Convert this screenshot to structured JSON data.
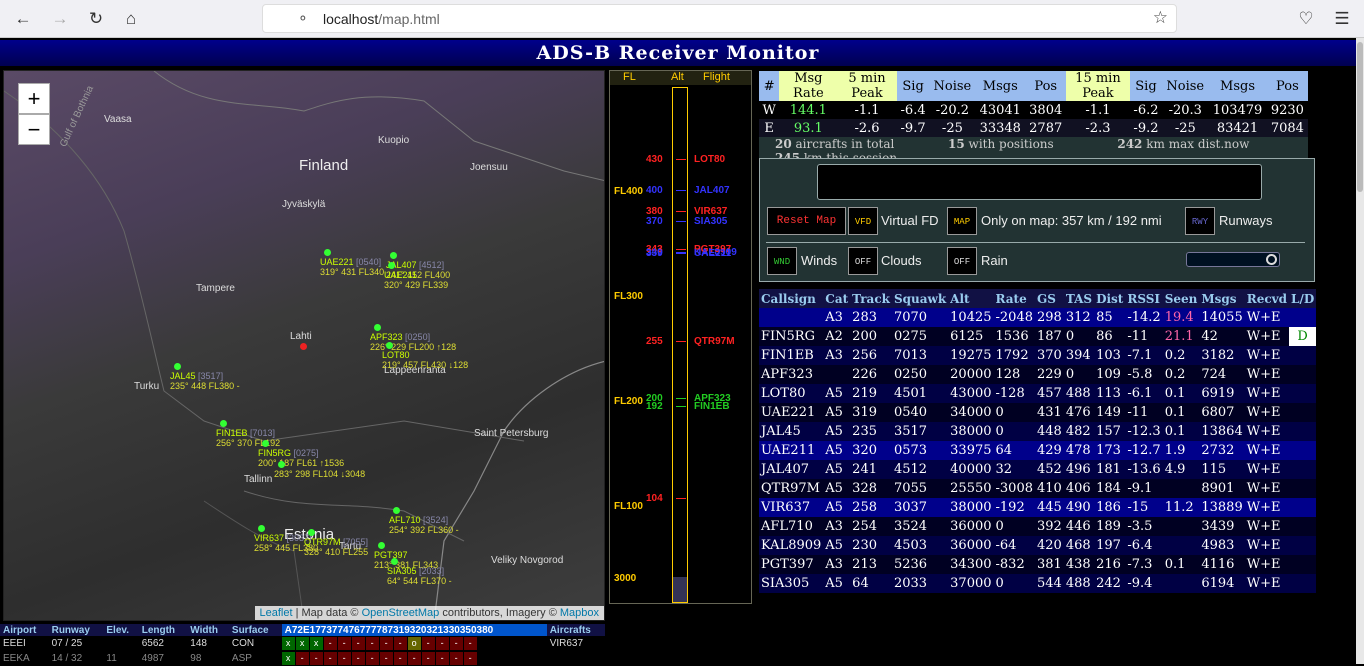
{
  "browser": {
    "url_host": "localhost",
    "url_path": "/map.html"
  },
  "title": "ADS-B Receiver Monitor",
  "map": {
    "zoom_in": "+",
    "zoom_out": "−",
    "cities": [
      {
        "name": "Finland",
        "big": true
      },
      {
        "name": "Vaasa"
      },
      {
        "name": "Kuopio"
      },
      {
        "name": "Joensuu"
      },
      {
        "name": "Jyväskylä"
      },
      {
        "name": "Tampere"
      },
      {
        "name": "Lahti"
      },
      {
        "name": "Lappeenranta"
      },
      {
        "name": "Turku"
      },
      {
        "name": "Tallinn"
      },
      {
        "name": "Estonia",
        "big": true
      },
      {
        "name": "Saint Petersburg"
      },
      {
        "name": "Tartu"
      },
      {
        "name": "Veliky Novgorod"
      },
      {
        "name": "Gulf of Bothnia"
      }
    ],
    "aircraft_labels": [
      {
        "cs": "UAE221",
        "sq": "[0540]",
        "info": "319° 431 FL340"
      },
      {
        "cs": "JAL407",
        "sq": "[4512]",
        "info": "241° 452 FL400"
      },
      {
        "cs": "UAE211",
        "sq": "",
        "info": "320° 429 FL339"
      },
      {
        "cs": "APF323",
        "sq": "[0250]",
        "info": "226° 229 FL200 ↑128"
      },
      {
        "cs": "LOT80",
        "sq": "",
        "info": "219° 457 FL430 ↓128"
      },
      {
        "cs": "JAL45",
        "sq": "[3517]",
        "info": "235° 448 FL380 -"
      },
      {
        "cs": "FIN1EB",
        "sq": "[7013]",
        "info": "256° 370 FL192"
      },
      {
        "cs": "FIN5RG",
        "sq": "[0275]",
        "info": "200° 187 FL61 ↑1536"
      },
      {
        "cs": "",
        "sq": "",
        "info": "283° 298 FL104 ↓3048"
      },
      {
        "cs": "AFL710",
        "sq": "[3524]",
        "info": "254° 392 FL360 -"
      },
      {
        "cs": "VIR637",
        "sq": "[3037]",
        "info": "258° 445 FL380"
      },
      {
        "cs": "QTR97M",
        "sq": "[7055]",
        "info": "328° 410 FL255"
      },
      {
        "cs": "PGT397",
        "sq": "",
        "info": "213° 381 FL343"
      },
      {
        "cs": "SIA305",
        "sq": "[2033]",
        "info": "64° 544 FL370 -"
      }
    ],
    "attribution": {
      "leaflet": "Leaflet",
      "mid": " | Map data © ",
      "osm": "OpenStreetMap",
      "mid2": " contributors, Imagery © ",
      "mapbox": "Mapbox"
    }
  },
  "altitude_panel": {
    "headers": [
      "FL",
      "Alt",
      "Flight"
    ],
    "scale": [
      "FL400",
      "FL300",
      "FL200",
      "FL100",
      "3000"
    ],
    "entries": [
      {
        "alt": "430",
        "flight": "LOT80",
        "color": "#f22"
      },
      {
        "alt": "400",
        "flight": "JAL407",
        "color": "#33f"
      },
      {
        "alt": "380",
        "flight": "VIR637",
        "color": "#f22"
      },
      {
        "alt": "370",
        "flight": "SIA305",
        "color": "#33f"
      },
      {
        "alt": "340",
        "flight": "KAL8909",
        "color": "#33f"
      },
      {
        "alt": "343",
        "flight": "PGT397",
        "color": "#f22"
      },
      {
        "alt": "339",
        "flight": "UAE211",
        "color": "#33f"
      },
      {
        "alt": "255",
        "flight": "QTR97M",
        "color": "#f22"
      },
      {
        "alt": "200",
        "flight": "APF323",
        "color": "#2c2"
      },
      {
        "alt": "192",
        "flight": "FIN1EB",
        "color": "#2c2"
      },
      {
        "alt": "104",
        "flight": "",
        "color": "#f22"
      }
    ]
  },
  "stats": {
    "headers": [
      "#",
      "Msg Rate",
      "5 min Peak",
      "Sig",
      "Noise",
      "Msgs",
      "Pos",
      "15 min Peak",
      "Sig",
      "Noise",
      "Msgs",
      "Pos"
    ],
    "rows": [
      [
        "W",
        "144.1",
        "-1.1",
        "-6.4",
        "-20.2",
        "43041",
        "3804",
        "-1.1",
        "-6.2",
        "-20.3",
        "103479",
        "9230"
      ],
      [
        "E",
        "93.1",
        "-2.6",
        "-9.7",
        "-25",
        "33348",
        "2787",
        "-2.3",
        "-9.2",
        "-25",
        "83421",
        "7084"
      ]
    ],
    "summary": {
      "total": "20",
      "total_txt": "aircrafts in total",
      "pos": "15",
      "pos_txt": "with positions",
      "maxnow": "242",
      "maxnow_txt": "km max dist.now",
      "maxsess": "245",
      "maxsess_txt": "km this session"
    }
  },
  "controls": {
    "reset_map": "Reset Map",
    "vfd_icon": "VFD",
    "virtual_fd": "Virtual FD",
    "map_icon": "MAP",
    "only_on_map": "Only on map: 357 km / 192 nmi",
    "rwy_icon": "RWY",
    "runways": "Runways",
    "wnd_icon": "WND",
    "winds": "Winds",
    "clouds_icon": "OFF",
    "clouds": "Clouds",
    "rain_icon": "OFF",
    "rain": "Rain"
  },
  "flights": {
    "headers": [
      "Callsign",
      "Cat",
      "Track",
      "Squawk",
      "Alt",
      "Rate",
      "GS",
      "TAS",
      "Dist",
      "RSSI",
      "Seen",
      "Msgs",
      "Recvd",
      "L/D"
    ],
    "rows": [
      [
        "",
        "A3",
        "283",
        "7070",
        "10425",
        "-2048",
        "298",
        "312",
        "85",
        "-14.2",
        "19.4",
        "14055",
        "W+E",
        ""
      ],
      [
        "FIN5RG",
        "A2",
        "200",
        "0275",
        "6125",
        "1536",
        "187",
        "0",
        "86",
        "-11",
        "21.1",
        "42",
        "W+E",
        "D"
      ],
      [
        "FIN1EB",
        "A3",
        "256",
        "7013",
        "19275",
        "1792",
        "370",
        "394",
        "103",
        "-7.1",
        "0.2",
        "3182",
        "W+E",
        ""
      ],
      [
        "APF323",
        "",
        "226",
        "0250",
        "20000",
        "128",
        "229",
        "0",
        "109",
        "-5.8",
        "0.2",
        "724",
        "W+E",
        ""
      ],
      [
        "LOT80",
        "A5",
        "219",
        "4501",
        "43000",
        "-128",
        "457",
        "488",
        "113",
        "-6.1",
        "0.1",
        "6919",
        "W+E",
        ""
      ],
      [
        "UAE221",
        "A5",
        "319",
        "0540",
        "34000",
        "0",
        "431",
        "476",
        "149",
        "-11",
        "0.1",
        "6807",
        "W+E",
        ""
      ],
      [
        "JAL45",
        "A5",
        "235",
        "3517",
        "38000",
        "0",
        "448",
        "482",
        "157",
        "-12.3",
        "0.1",
        "13864",
        "W+E",
        ""
      ],
      [
        "UAE211",
        "A5",
        "320",
        "0573",
        "33975",
        "64",
        "429",
        "478",
        "173",
        "-12.7",
        "1.9",
        "2732",
        "W+E",
        ""
      ],
      [
        "JAL407",
        "A5",
        "241",
        "4512",
        "40000",
        "32",
        "452",
        "496",
        "181",
        "-13.6",
        "4.9",
        "115",
        "W+E",
        ""
      ],
      [
        "QTR97M",
        "A5",
        "328",
        "7055",
        "25550",
        "-3008",
        "410",
        "406",
        "184",
        "-9.1",
        "",
        "8901",
        "W+E",
        ""
      ],
      [
        "VIR637",
        "A5",
        "258",
        "3037",
        "38000",
        "-192",
        "445",
        "490",
        "186",
        "-15",
        "11.2",
        "13889",
        "W+E",
        ""
      ],
      [
        "AFL710",
        "A3",
        "254",
        "3524",
        "36000",
        "0",
        "392",
        "446",
        "189",
        "-3.5",
        "",
        "3439",
        "W+E",
        ""
      ],
      [
        "KAL8909",
        "A5",
        "230",
        "4503",
        "36000",
        "-64",
        "420",
        "468",
        "197",
        "-6.4",
        "",
        "4983",
        "W+E",
        ""
      ],
      [
        "PGT397",
        "A3",
        "213",
        "5236",
        "34300",
        "-832",
        "381",
        "438",
        "216",
        "-7.3",
        "0.1",
        "4116",
        "W+E",
        ""
      ],
      [
        "SIA305",
        "A5",
        "64",
        "2033",
        "37000",
        "0",
        "544",
        "488",
        "242",
        "-9.4",
        "",
        "6194",
        "W+E",
        ""
      ]
    ]
  },
  "airports": {
    "headers": [
      "Airport",
      "Runway",
      "Elev.",
      "Length",
      "Width",
      "Surface",
      "A72E177377476777787319320321330350380",
      "Aircrafts"
    ],
    "rows": [
      {
        "airport": "EEEI",
        "runway": "07 / 25",
        "elev": "",
        "length": "6562",
        "width": "148",
        "surface": "CON",
        "cells": [
          "x",
          "x",
          "x",
          "-",
          "-",
          "-",
          "-",
          "-",
          "-",
          "o",
          "-",
          "-",
          "-",
          "-"
        ],
        "aircrafts": "VIR637"
      },
      {
        "airport": "EEKA",
        "runway": "14 / 32",
        "elev": "11",
        "length": "4987",
        "width": "98",
        "surface": "ASP",
        "cells": [
          "x",
          "-",
          "-",
          "-",
          "-",
          "-",
          "-",
          "-",
          "-",
          "-",
          "-",
          "-",
          "-",
          "-"
        ],
        "aircrafts": ""
      }
    ]
  }
}
